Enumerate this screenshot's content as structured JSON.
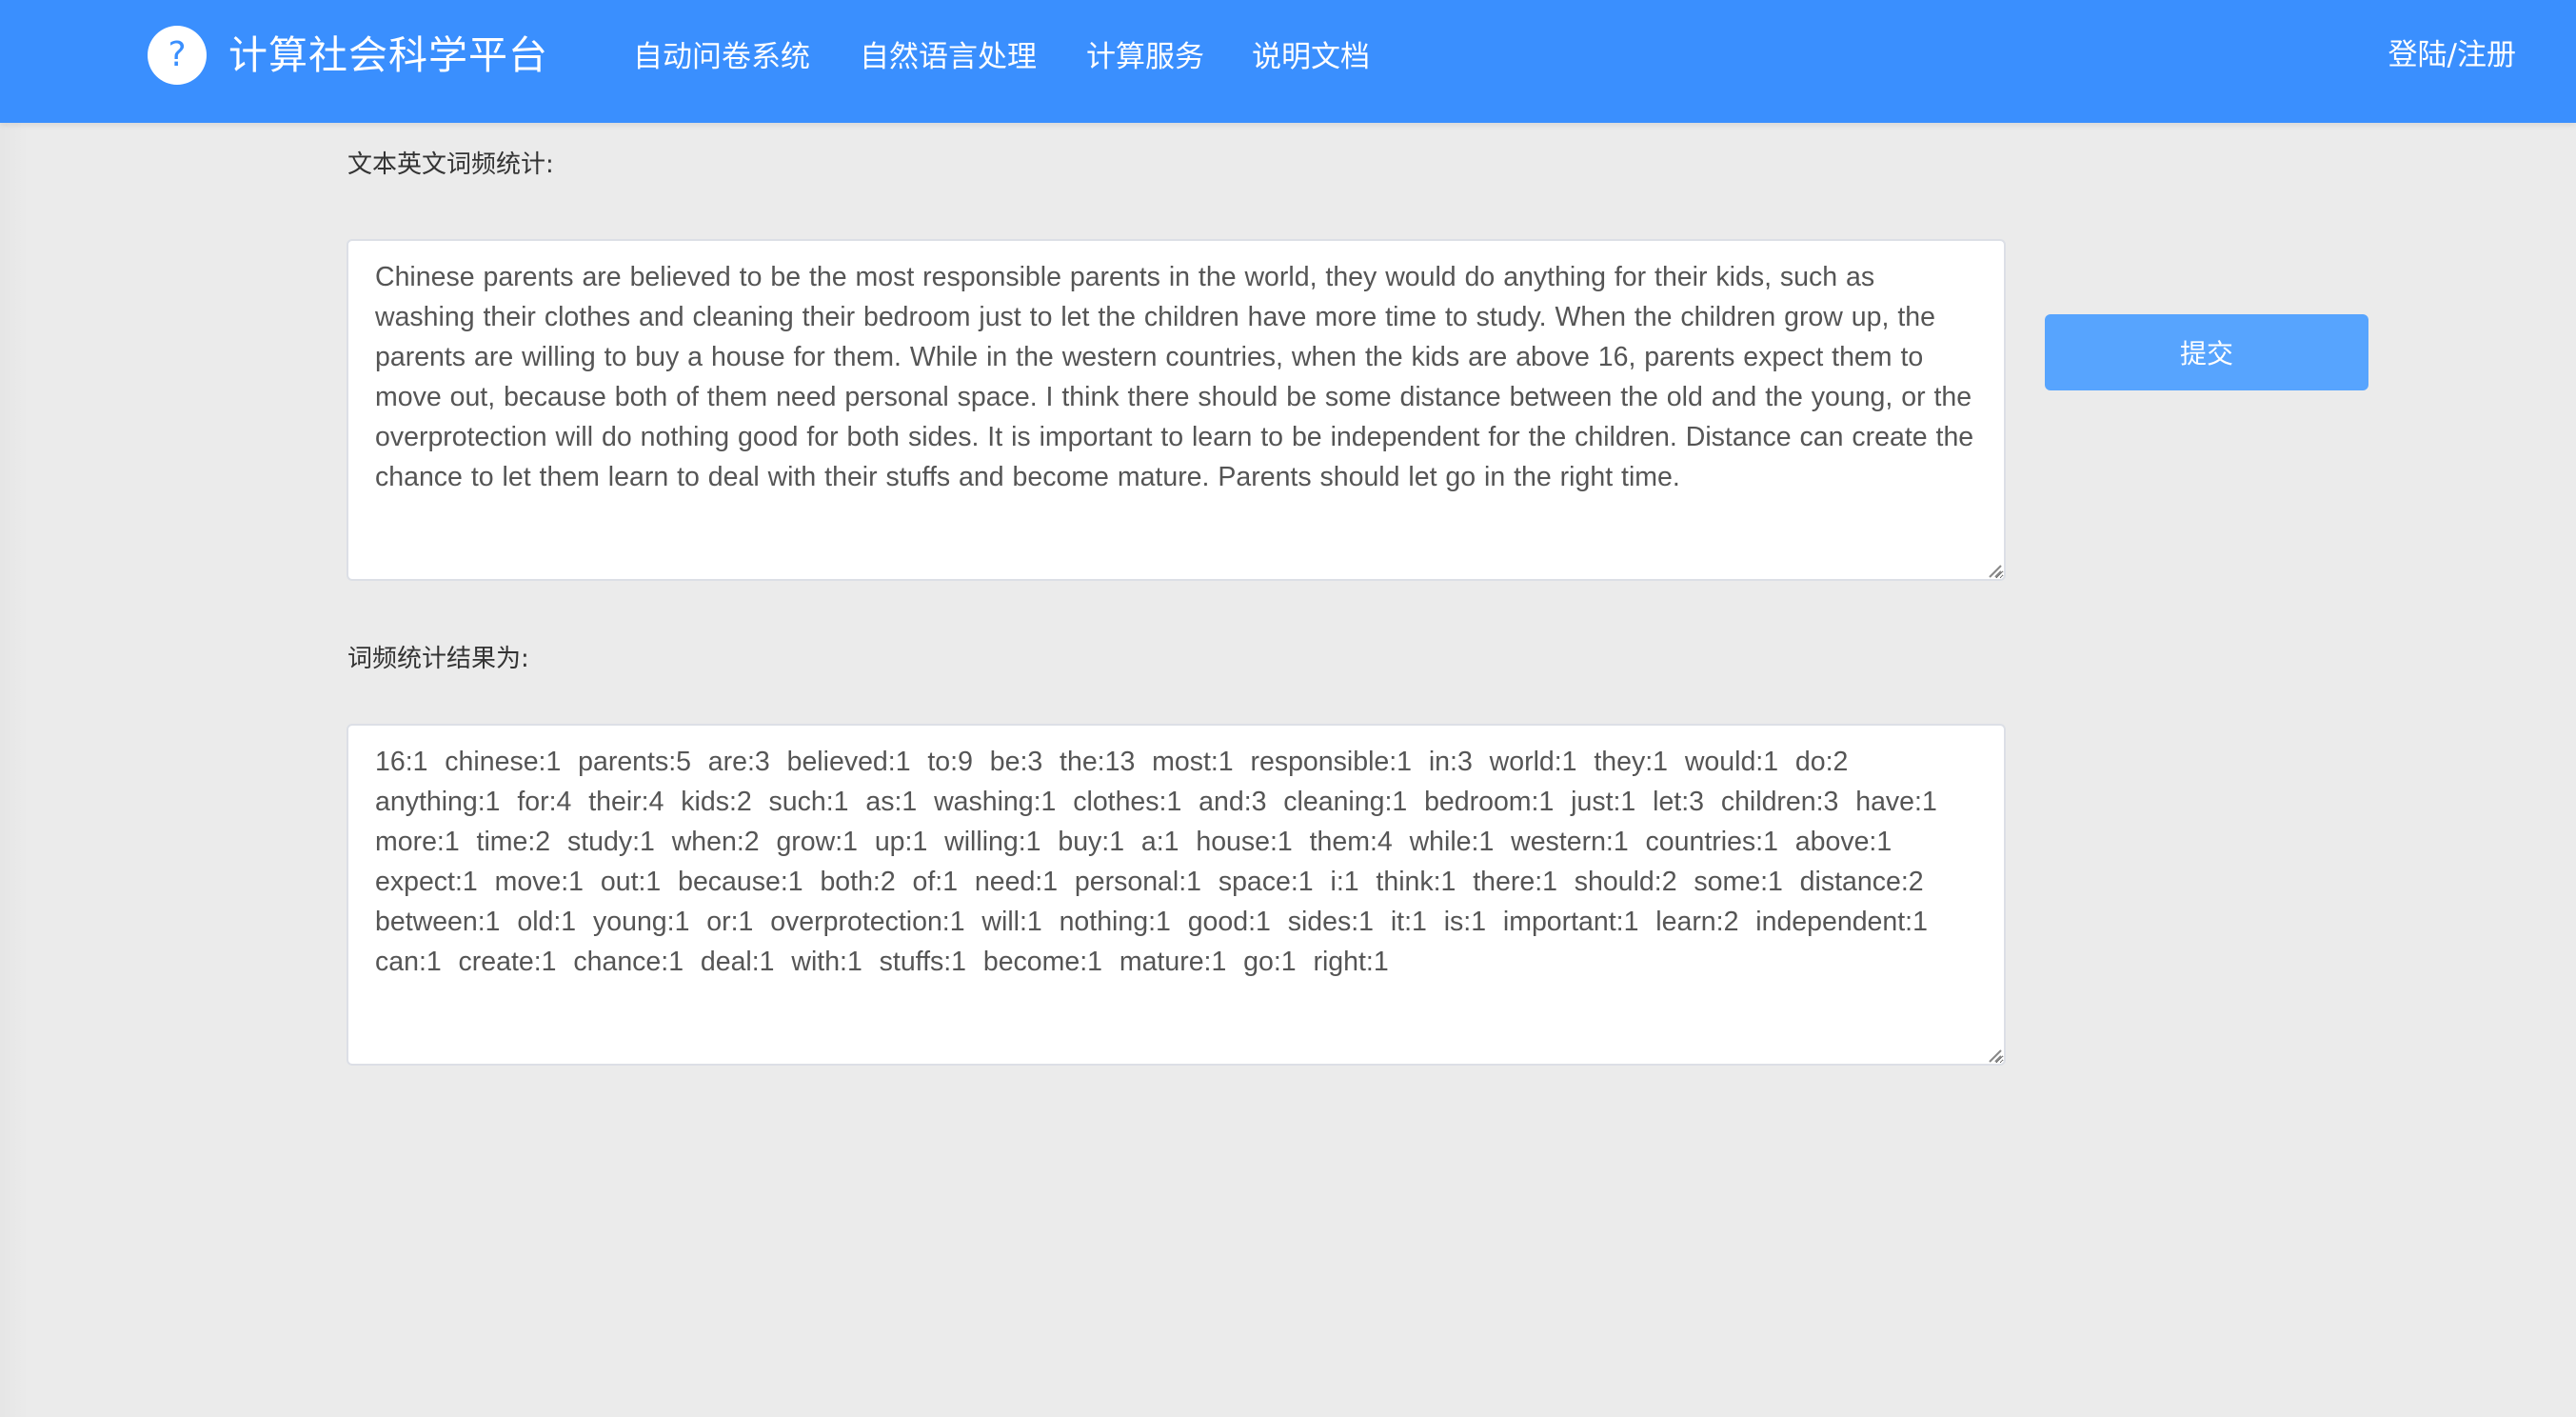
{
  "header": {
    "logo_glyph": "?",
    "brand": "计算社会科学平台",
    "nav": [
      {
        "label": "自动问卷系统"
      },
      {
        "label": "自然语言处理"
      },
      {
        "label": "计算服务"
      },
      {
        "label": "说明文档"
      }
    ],
    "login": "登陆/注册",
    "colors": {
      "bar": "#3a8ffe",
      "button": "#57a4fe"
    }
  },
  "form": {
    "input_label": "文本英文词频统计:",
    "input_text": "Chinese parents are believed to be the most responsible parents in the world, they would do anything for their kids, such as washing their clothes and cleaning their bedroom just to let the children have more time to study. When the children grow up, the parents are willing to buy a house for them. While in the western countries, when the kids are above 16, parents expect them to move out, because both of them need personal space. I think there should be some distance between the old and the young, or the overprotection will do nothing good for both sides. It is important to learn to be independent for the children. Distance can create the chance to let them learn to deal with their stuffs and become mature. Parents should let go in the right time.",
    "submit_label": "提交",
    "result_label": "词频统计结果为:",
    "result_text": "16:1  chinese:1  parents:5  are:3  believed:1  to:9  be:3  the:13  most:1  responsible:1  in:3  world:1  they:1  would:1  do:2  anything:1  for:4  their:4  kids:2  such:1  as:1  washing:1  clothes:1  and:3  cleaning:1  bedroom:1  just:1  let:3  children:3  have:1  more:1  time:2  study:1  when:2  grow:1  up:1  willing:1  buy:1  a:1  house:1  them:4  while:1  western:1  countries:1  above:1  expect:1  move:1  out:1  because:1  both:2  of:1  need:1  personal:1  space:1  i:1  think:1  there:1  should:2  some:1  distance:2  between:1  old:1  young:1  or:1  overprotection:1  will:1  nothing:1  good:1  sides:1  it:1  is:1  important:1  learn:2  independent:1  can:1  create:1  chance:1  deal:1  with:1  stuffs:1  become:1  mature:1  go:1  right:1"
  }
}
